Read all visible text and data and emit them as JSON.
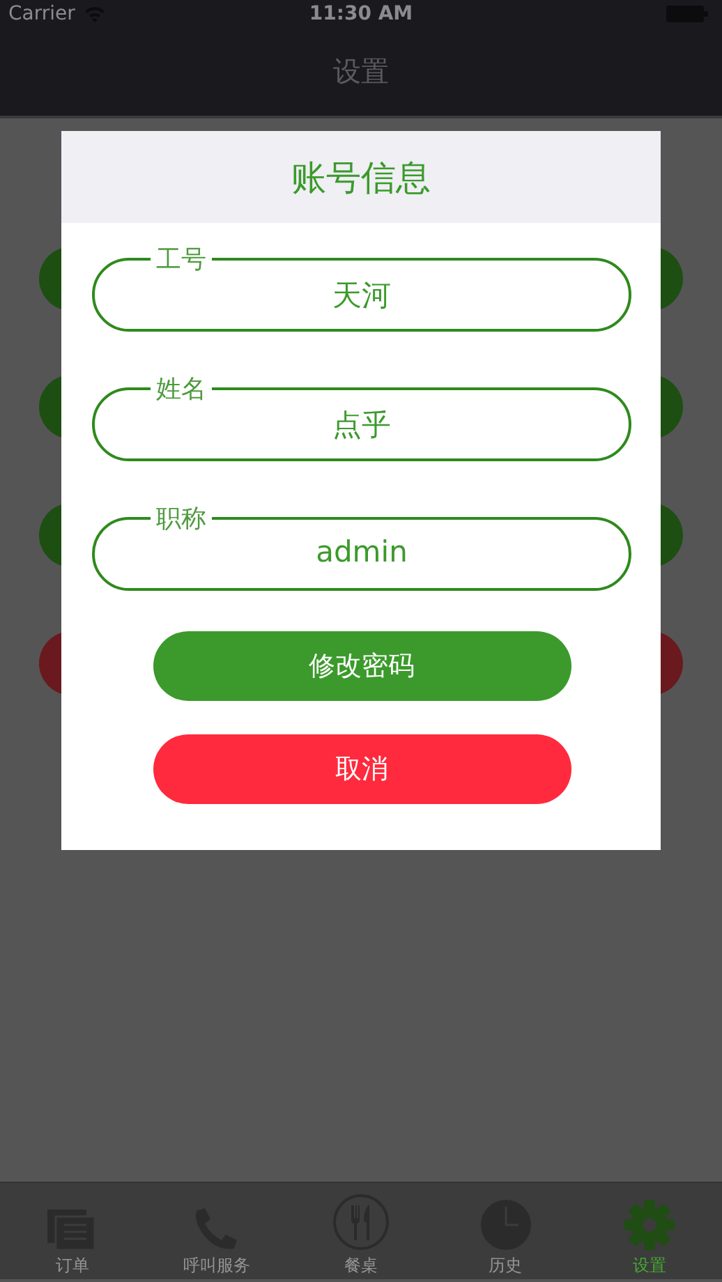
{
  "status_bar": {
    "carrier": "Carrier",
    "time": "11:30 AM"
  },
  "nav_bar": {
    "title": "设置"
  },
  "background_buttons": [
    {
      "color": "#1d4f12"
    },
    {
      "color": "#1d4f12"
    },
    {
      "color": "#1d4f12"
    },
    {
      "color": "#6a1a1e"
    }
  ],
  "dialog": {
    "title": "账号信息",
    "fields": [
      {
        "label": "工号",
        "value": "天河"
      },
      {
        "label": "姓名",
        "value": "点乎"
      },
      {
        "label": "职称",
        "value": "admin"
      }
    ],
    "buttons": [
      {
        "label": "修改密码",
        "kind": "primary"
      },
      {
        "label": "取消",
        "kind": "danger"
      }
    ]
  },
  "tab_bar": [
    {
      "label": "订单",
      "kind": "orders",
      "selected": false
    },
    {
      "label": "呼叫服务",
      "kind": "phone",
      "selected": false
    },
    {
      "label": "餐桌",
      "kind": "cutlery",
      "selected": false
    },
    {
      "label": "历史",
      "kind": "clock",
      "selected": false
    },
    {
      "label": "设置",
      "kind": "gear",
      "selected": true
    }
  ]
}
